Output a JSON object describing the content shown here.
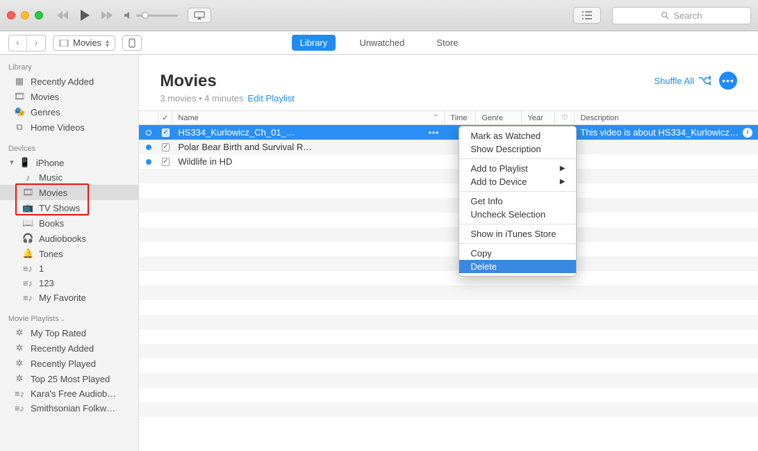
{
  "search_placeholder": "Search",
  "media_selector": "Movies",
  "tabs": {
    "library": "Library",
    "unwatched": "Unwatched",
    "store": "Store"
  },
  "sidebar": {
    "library_h": "Library",
    "library": [
      {
        "label": "Recently Added"
      },
      {
        "label": "Movies"
      },
      {
        "label": "Genres"
      },
      {
        "label": "Home Videos"
      }
    ],
    "devices_h": "Devices",
    "device_name": "iPhone",
    "device_items": [
      {
        "label": "Music"
      },
      {
        "label": "Movies"
      },
      {
        "label": "TV Shows"
      },
      {
        "label": "Books"
      },
      {
        "label": "Audiobooks"
      },
      {
        "label": "Tones"
      },
      {
        "label": "1"
      },
      {
        "label": "123"
      },
      {
        "label": "My Favorite"
      }
    ],
    "playlists_h": "Movie Playlists",
    "playlists": [
      {
        "label": "My Top Rated"
      },
      {
        "label": "Recently Added"
      },
      {
        "label": "Recently Played"
      },
      {
        "label": "Top 25 Most Played"
      },
      {
        "label": "Kara's Free Audiob…"
      },
      {
        "label": "Smithsonian Folkw…"
      }
    ]
  },
  "header": {
    "title": "Movies",
    "subtitle": "3 movies • 4 minutes",
    "edit": "Edit Playlist",
    "shuffle": "Shuffle All"
  },
  "columns": {
    "name": "Name",
    "time": "Time",
    "genre": "Genre",
    "year": "Year",
    "desc": "Description"
  },
  "rows": [
    {
      "name": "HS334_Kurlowicz_Ch_01_…",
      "desc": "This video is about HS334_Kurlowicz…",
      "selected": true
    },
    {
      "name": "Polar Bear Birth and Survival R…",
      "desc": "",
      "selected": false
    },
    {
      "name": "Wildlife in HD",
      "desc": "",
      "selected": false
    }
  ],
  "context_menu": {
    "mark_watched": "Mark as Watched",
    "show_desc": "Show Description",
    "add_playlist": "Add to Playlist",
    "add_device": "Add to Device",
    "get_info": "Get Info",
    "uncheck": "Uncheck Selection",
    "show_store": "Show in iTunes Store",
    "copy": "Copy",
    "delete": "Delete"
  }
}
